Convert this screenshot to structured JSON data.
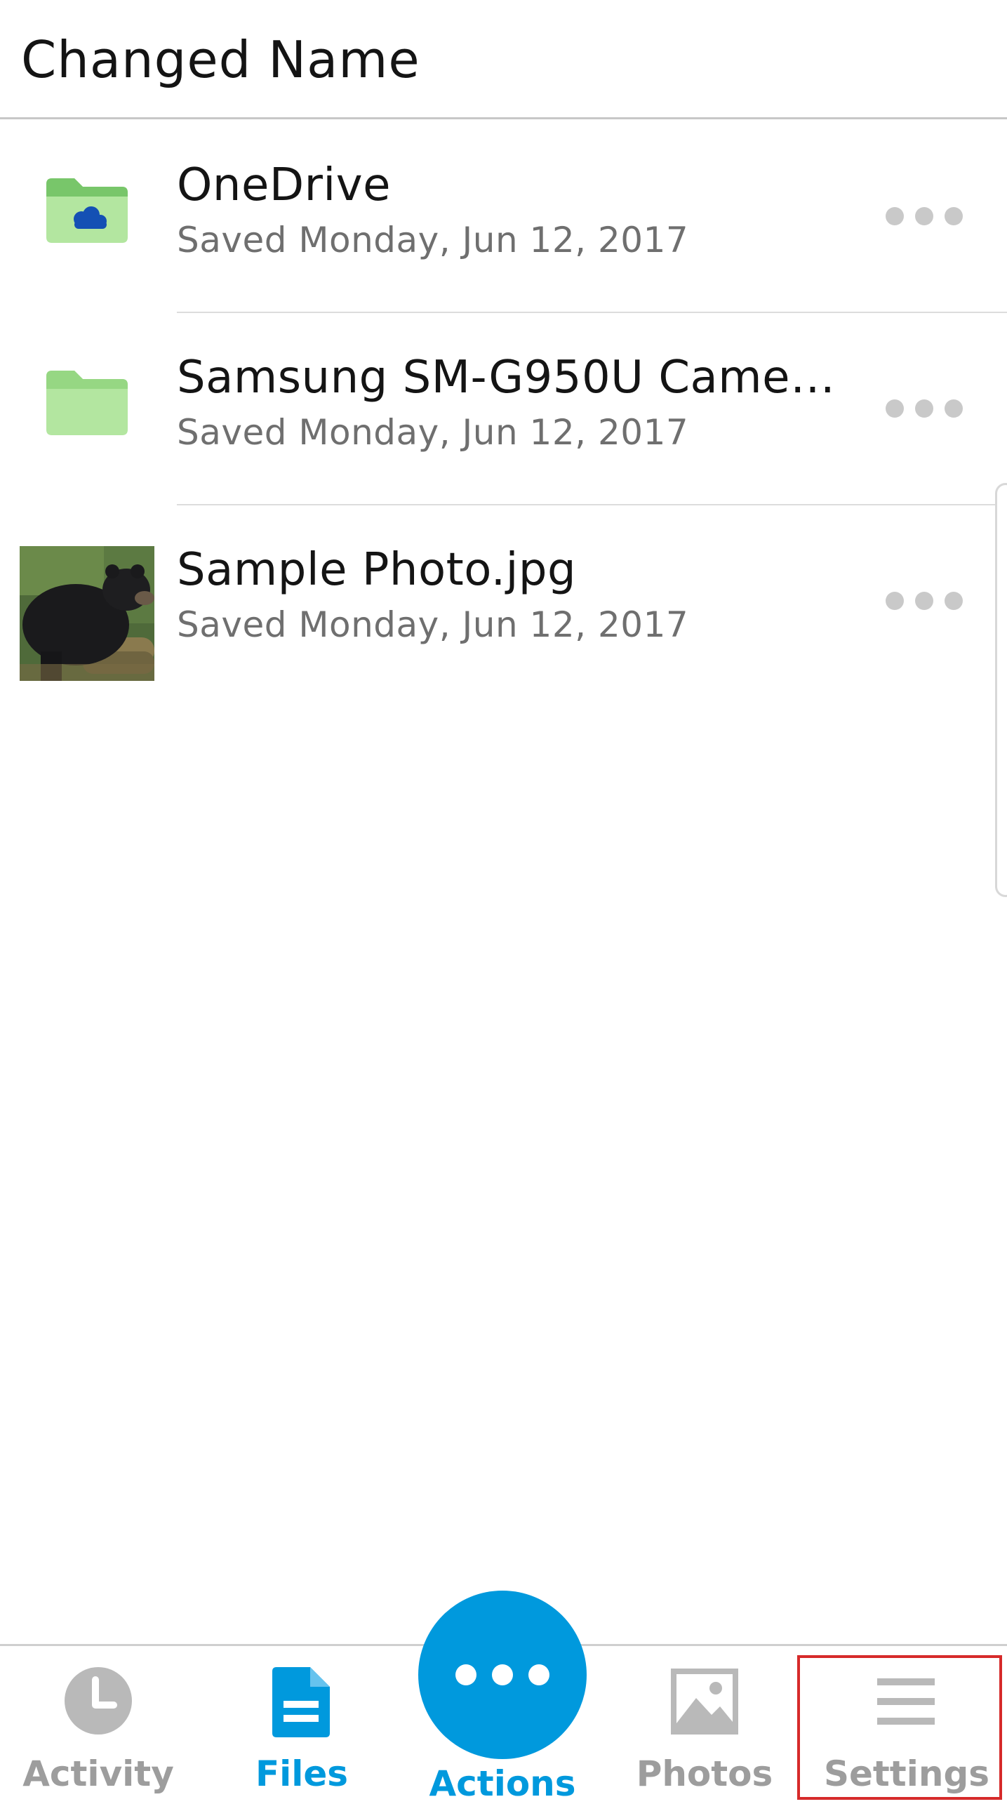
{
  "header": {
    "title": "Changed Name"
  },
  "files": [
    {
      "name": "OneDrive",
      "meta": "Saved Monday, Jun 12, 2017",
      "icon": "onedrive-folder-icon"
    },
    {
      "name": "Samsung SM-G950U Came…",
      "meta": "Saved Monday, Jun 12, 2017",
      "icon": "folder-icon"
    },
    {
      "name": "Sample Photo.jpg",
      "meta": "Saved Monday, Jun 12, 2017",
      "icon": "photo-thumbnail"
    }
  ],
  "tabs": {
    "activity": "Activity",
    "files": "Files",
    "actions": "Actions",
    "photos": "Photos",
    "settings": "Settings"
  },
  "colors": {
    "accent": "#0099dd",
    "folder": "#b3e6a0",
    "folder_tab": "#78c66a",
    "inactive": "#9d9d9d",
    "highlight": "#d62a2a"
  }
}
